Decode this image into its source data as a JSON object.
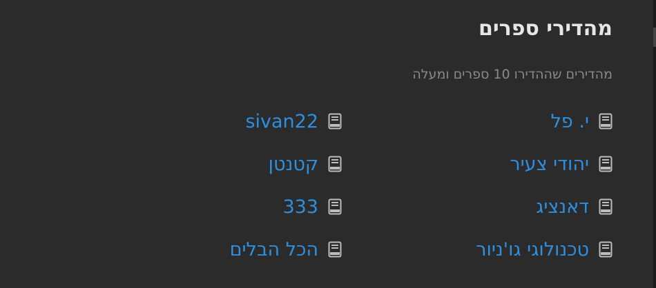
{
  "title": "מהדירי ספרים",
  "subtitle": "מהדירים שההדירו 10 ספרים ומעלה",
  "icon": "book-icon",
  "colors": {
    "background": "#2b2b2b",
    "link": "#2f8fdf",
    "title": "#e6e6e6",
    "subtitle": "#8a8a8a"
  },
  "column_1": [
    {
      "label": "י. פל"
    },
    {
      "label": "יהודי צעיר"
    },
    {
      "label": "דאנציג"
    },
    {
      "label": "טכנולוגי גו'ניור"
    }
  ],
  "column_2": [
    {
      "label": "sivan22"
    },
    {
      "label": "קטנטן"
    },
    {
      "label": "333"
    },
    {
      "label": "הכל הבלים"
    }
  ]
}
